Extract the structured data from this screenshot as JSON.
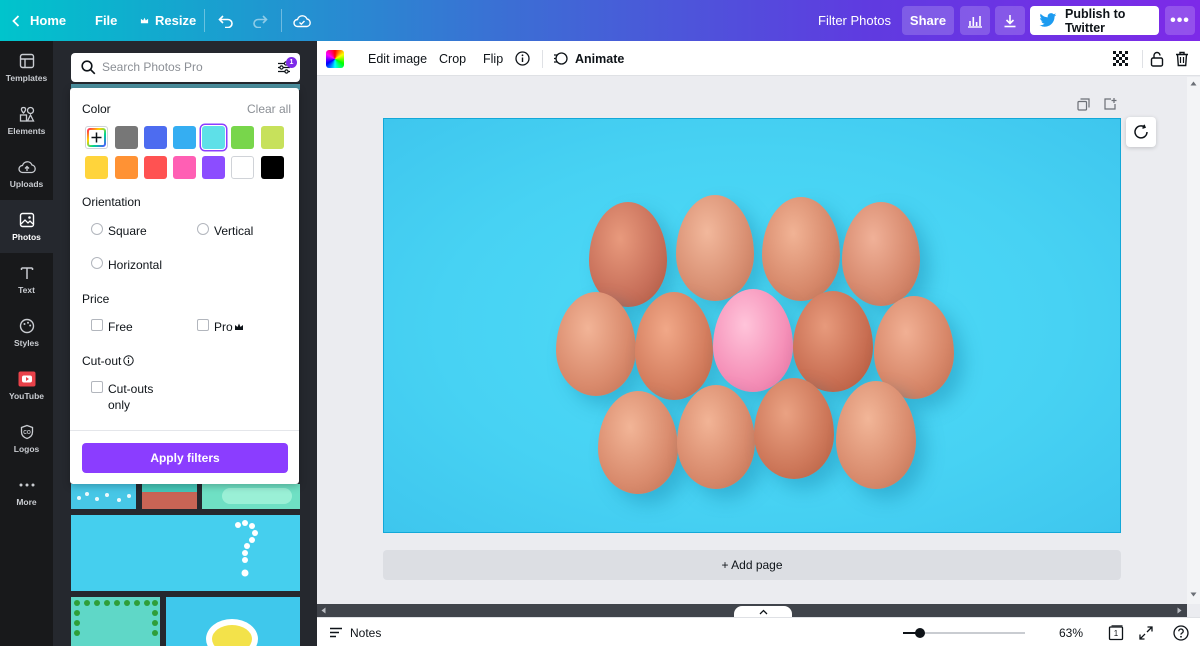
{
  "topbar": {
    "home_label": "Home",
    "file_label": "File",
    "resize_label": "Resize",
    "filter_label": "Filter Photos",
    "share_label": "Share",
    "publish_label": "Publish to Twitter",
    "more_label": "•••"
  },
  "rail": {
    "items": [
      {
        "label": "Templates",
        "icon": "templates-icon"
      },
      {
        "label": "Elements",
        "icon": "elements-icon"
      },
      {
        "label": "Uploads",
        "icon": "uploads-icon"
      },
      {
        "label": "Photos",
        "icon": "photos-icon"
      },
      {
        "label": "Text",
        "icon": "text-icon"
      },
      {
        "label": "Styles",
        "icon": "styles-icon"
      },
      {
        "label": "YouTube",
        "icon": "youtube-icon"
      },
      {
        "label": "Logos",
        "icon": "logos-icon"
      },
      {
        "label": "More",
        "icon": "more-icon"
      }
    ]
  },
  "search": {
    "placeholder": "Search Photos Pro",
    "filter_count": "1"
  },
  "filters": {
    "color_heading": "Color",
    "clear_all": "Clear all",
    "colors": [
      "#777777",
      "#4d6cf0",
      "#35aef2",
      "#5ee0e8",
      "#78d64b",
      "#c7e15b",
      "#ffd43b",
      "#ff9234",
      "#ff5252",
      "#ff5fb4",
      "#8c4dff",
      "#ffffff",
      "#000000"
    ],
    "selected_color": "#5ee0e8",
    "orientation_heading": "Orientation",
    "orientation_options": [
      "Square",
      "Vertical",
      "Horizontal"
    ],
    "price_heading": "Price",
    "price_options": [
      "Free",
      "Pro"
    ],
    "cutout_heading": "Cut-out",
    "cutout_option_line1": "Cut-outs",
    "cutout_option_line2": "only",
    "apply_label": "Apply filters"
  },
  "context_toolbar": {
    "edit_image": "Edit image",
    "crop": "Crop",
    "flip": "Flip",
    "animate": "Animate"
  },
  "canvas": {
    "add_page_label": "+ Add page",
    "background_color": "#47d2f3"
  },
  "bottombar": {
    "notes_label": "Notes",
    "zoom_label": "63%",
    "zoom_level": 0.63,
    "page_count": "1"
  }
}
